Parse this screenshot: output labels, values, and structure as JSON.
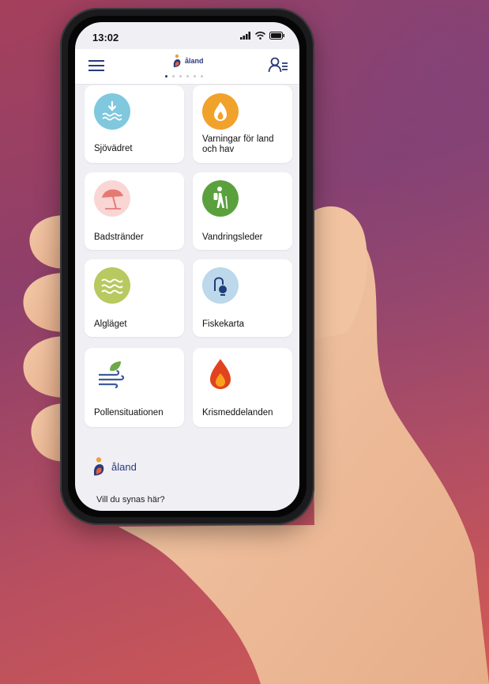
{
  "status": {
    "time": "13:02"
  },
  "header": {
    "brand": "åland"
  },
  "tiles": [
    {
      "label": "Sjövädret",
      "icon": "sea-weather-icon",
      "color": "#7fc8dd"
    },
    {
      "label": "Varningar för land och hav",
      "icon": "warning-flame-icon",
      "color": "#f0a22a"
    },
    {
      "label": "Badstränder",
      "icon": "beach-umbrella-icon",
      "color": "#f9d6d4"
    },
    {
      "label": "Vandringsleder",
      "icon": "hiker-icon",
      "color": "#5aa13e"
    },
    {
      "label": "Algläget",
      "icon": "algae-waves-icon",
      "color": "#b7c95f"
    },
    {
      "label": "Fiskekarta",
      "icon": "fishing-hook-icon",
      "color": "#bcd8ea"
    },
    {
      "label": "Pollensituationen",
      "icon": "pollen-wind-icon",
      "color": "#6fa84a"
    },
    {
      "label": "Krismeddelanden",
      "icon": "crisis-drop-icon",
      "color": "#e2431f"
    }
  ],
  "footer": {
    "brand": "åland",
    "cta": "Vill du synas här?"
  }
}
